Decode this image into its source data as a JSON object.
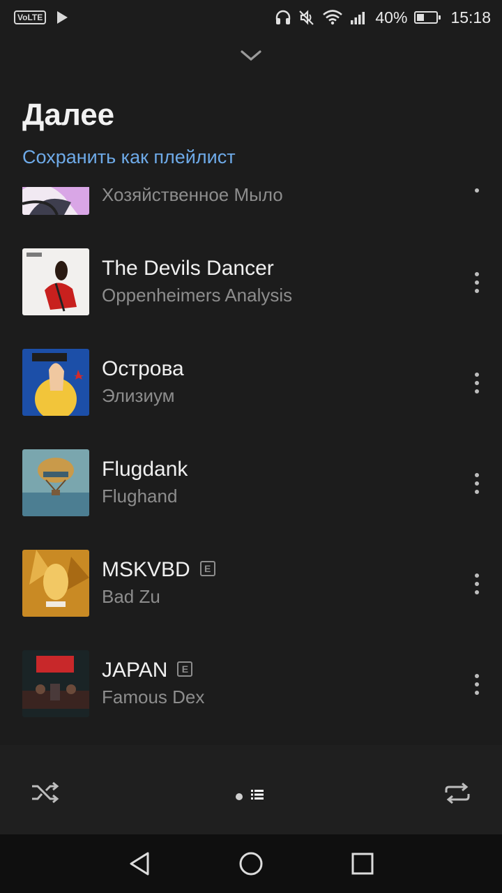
{
  "status_bar": {
    "volte": "VoLTE",
    "battery_pct": "40%",
    "battery_level": 0.4,
    "time": "15:18",
    "icons": [
      "play-icon",
      "headphones-icon",
      "mute-icon",
      "wifi-icon",
      "signal-icon",
      "battery-icon"
    ]
  },
  "header": {
    "title": "Далее",
    "save_label": "Сохранить как плейлист"
  },
  "tracks": [
    {
      "title": "",
      "artist": "Хозяйственное Мыло",
      "explicit": false
    },
    {
      "title": "The Devils Dancer",
      "artist": "Oppenheimers Analysis",
      "explicit": false
    },
    {
      "title": "Острова",
      "artist": "Элизиум",
      "explicit": false
    },
    {
      "title": "Flugdank",
      "artist": "Flughand",
      "explicit": false
    },
    {
      "title": "MSKVBD",
      "artist": "Bad Zu",
      "explicit": true
    },
    {
      "title": "JAPAN",
      "artist": "Famous Dex",
      "explicit": true
    }
  ],
  "badge_letter": "E",
  "controls": {
    "icons": [
      "shuffle-icon",
      "pager-dot",
      "queue-list-icon",
      "repeat-icon"
    ]
  },
  "colors": {
    "background": "#1c1c1c",
    "accent": "#6eaae8",
    "secondary_text": "#8d8d8d"
  }
}
